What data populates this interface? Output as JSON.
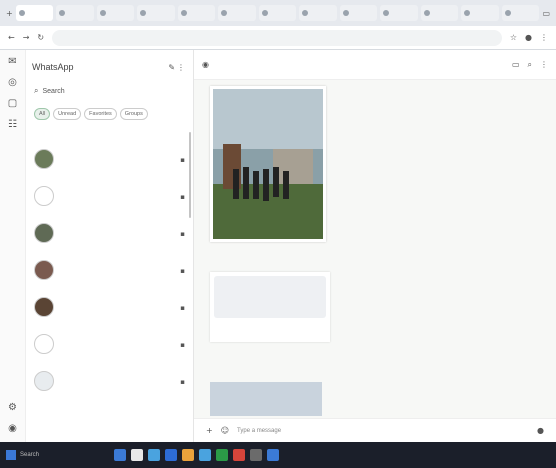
{
  "browser": {
    "tabs": [
      "",
      "",
      "",
      "",
      "",
      "",
      "",
      "",
      "",
      "",
      "",
      "",
      ""
    ],
    "url": ""
  },
  "sidebar": {
    "title": "WhatsApp",
    "search_placeholder": "Search",
    "chips": [
      "All",
      "Unread",
      "Favorites",
      "Groups"
    ],
    "archived_label": "",
    "chats": [
      {
        "name": "",
        "preview": "",
        "time": "",
        "color": "#6b7b5a"
      },
      {
        "name": "",
        "preview": "",
        "time": "",
        "color": "#ffffff"
      },
      {
        "name": "",
        "preview": "",
        "time": "",
        "color": "#5f6a55"
      },
      {
        "name": "",
        "preview": "",
        "time": "",
        "color": "#7a5a4f"
      },
      {
        "name": "",
        "preview": "",
        "time": "",
        "color": "#5a4434"
      },
      {
        "name": "",
        "preview": "",
        "time": "",
        "color": "#ffffff"
      },
      {
        "name": "",
        "preview": "",
        "time": "",
        "color": "#e8ecef"
      }
    ]
  },
  "main": {
    "title": "",
    "photo_time": "",
    "caption": "",
    "doc_name": "",
    "doc_size": "",
    "msg3": "",
    "composer_placeholder": "Type a message"
  },
  "taskbar": {
    "search": "Search",
    "right_text": ""
  }
}
